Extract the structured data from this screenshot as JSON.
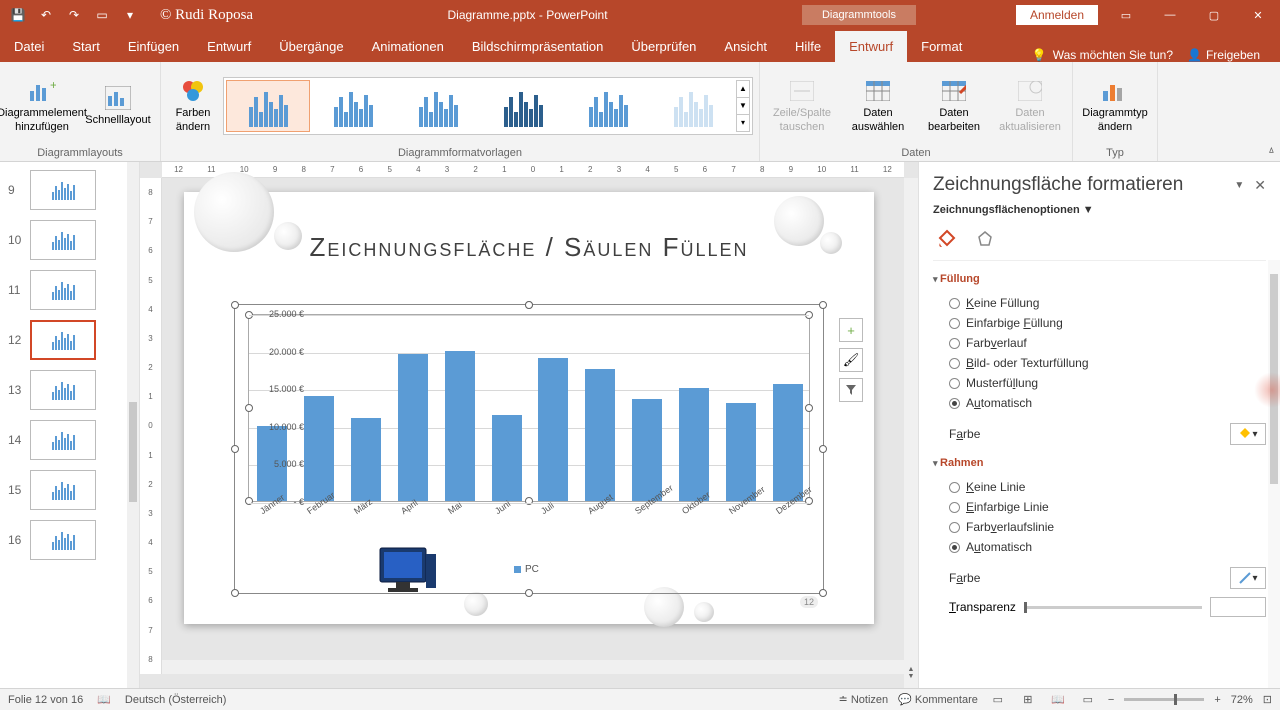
{
  "titlebar": {
    "author": "© Rudi Roposa",
    "filename": "Diagramme.pptx - PowerPoint",
    "context_tab": "Diagrammtools",
    "signin": "Anmelden"
  },
  "tabs": {
    "datei": "Datei",
    "start": "Start",
    "einfuegen": "Einfügen",
    "entwurf": "Entwurf",
    "uebergaenge": "Übergänge",
    "animationen": "Animationen",
    "bildschirm": "Bildschirmpräsentation",
    "ueberpruefen": "Überprüfen",
    "ansicht": "Ansicht",
    "hilfe": "Hilfe",
    "entwurf2": "Entwurf",
    "format": "Format",
    "tellme": "Was möchten Sie tun?",
    "share": "Freigeben"
  },
  "ribbon": {
    "add_element": "Diagrammelement hinzufügen",
    "quick_layout": "Schnelllayout",
    "colors": "Farben ändern",
    "group_layouts": "Diagrammlayouts",
    "group_styles": "Diagrammformatvorlagen",
    "swap": "Zeile/Spalte tauschen",
    "select_data": "Daten auswählen",
    "edit_data": "Daten bearbeiten",
    "refresh": "Daten aktualisieren",
    "group_data": "Daten",
    "change_type": "Diagrammtyp ändern",
    "group_type": "Typ"
  },
  "thumbs": [
    {
      "n": "9"
    },
    {
      "n": "10"
    },
    {
      "n": "11"
    },
    {
      "n": "12"
    },
    {
      "n": "13"
    },
    {
      "n": "14"
    },
    {
      "n": "15"
    },
    {
      "n": "16"
    }
  ],
  "slide": {
    "title": "Zeichnungsfläche / Säulen Füllen",
    "legend": "PC",
    "page_num": "12"
  },
  "chart_data": {
    "type": "bar",
    "title": "",
    "xlabel": "",
    "ylabel": "",
    "ylim": [
      0,
      25000
    ],
    "y_ticks": [
      "-   €",
      "5.000 €",
      "10.000 €",
      "15.000 €",
      "20.000 €",
      "25.000 €"
    ],
    "categories": [
      "Jänner",
      "Februar",
      "März",
      "April",
      "Mai",
      "Juni",
      "Juli",
      "August",
      "September",
      "Oktober",
      "November",
      "Dezember"
    ],
    "series": [
      {
        "name": "PC",
        "values": [
          10000,
          14000,
          11000,
          19500,
          20000,
          11500,
          19000,
          17500,
          13500,
          15000,
          13000,
          15500
        ]
      }
    ]
  },
  "fpane": {
    "title": "Zeichnungsfläche formatieren",
    "subtitle": "Zeichnungsflächenoptionen",
    "fill": "Füllung",
    "fill_opts": {
      "none": "Keine Füllung",
      "solid": "Einfarbige Füllung",
      "gradient": "Farbverlauf",
      "picture": "Bild- oder Texturfüllung",
      "pattern": "Musterfüllung",
      "auto": "Automatisch"
    },
    "color": "Farbe",
    "border": "Rahmen",
    "border_opts": {
      "none": "Keine Linie",
      "solid": "Einfarbige Linie",
      "gradient": "Farbverlaufslinie",
      "auto": "Automatisch"
    },
    "transparency": "Transparenz"
  },
  "statusbar": {
    "slide": "Folie 12 von 16",
    "lang": "Deutsch (Österreich)",
    "notes": "Notizen",
    "comments": "Kommentare",
    "zoom": "72%"
  }
}
